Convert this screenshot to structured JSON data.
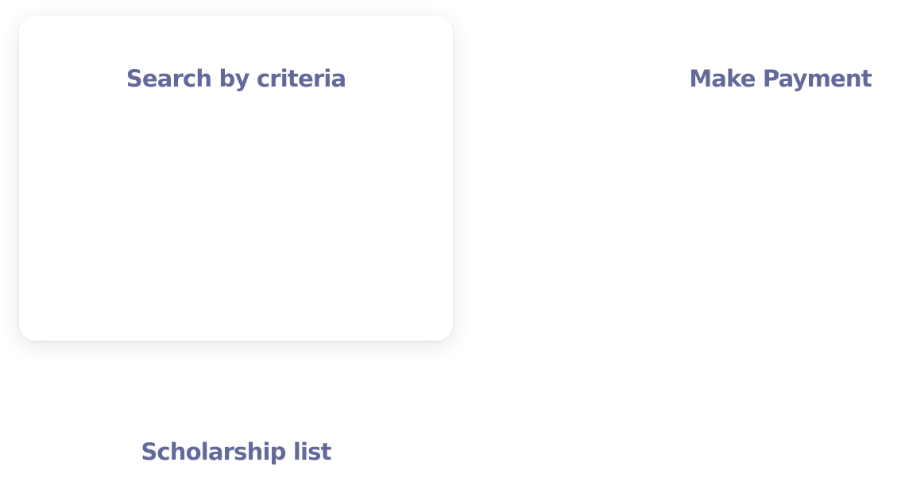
{
  "theme": {
    "title_color": "#63699a",
    "card_background": "#ffffff"
  },
  "cards": [
    {
      "title": "Search by criteria",
      "highlighted": true
    },
    {
      "title": "Make Payment",
      "highlighted": false
    },
    {
      "title": "Scholarship list",
      "highlighted": false
    }
  ]
}
